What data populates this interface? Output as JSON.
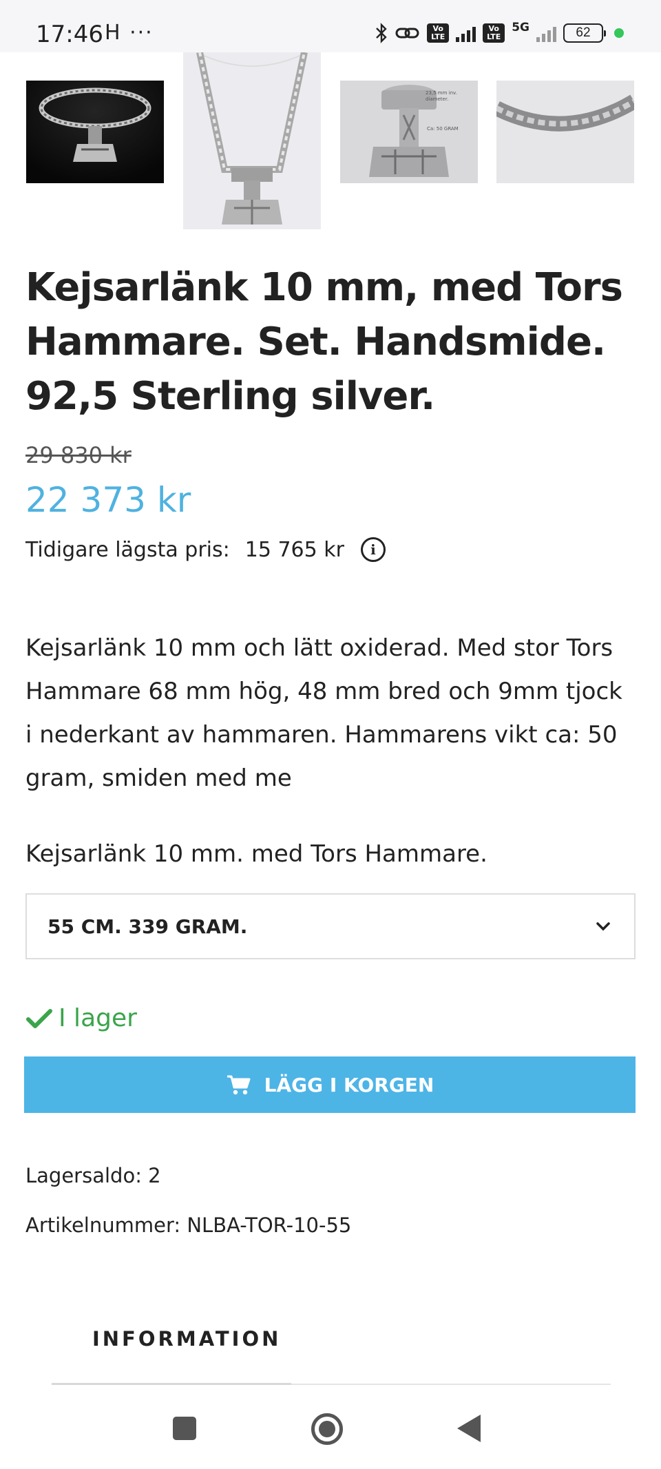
{
  "status_bar": {
    "time": "17:46",
    "left_icons": "H ···",
    "volte_label": "Vo LTE",
    "network": "5G",
    "battery": "62"
  },
  "gallery": {
    "thumb3_label1": "23,5 mm inv. diameter.",
    "thumb3_label2": "Ca: 50 GRAM"
  },
  "product": {
    "title": "Kejsarlänk 10 mm, med Tors Hammare. Set. Handsmide. 92,5 Sterling silver.",
    "old_price": "29 830 kr",
    "price": "22 373 kr",
    "lowest_label": "Tidigare lägsta pris:",
    "lowest_value": "15 765 kr",
    "description": "Kejsarlänk 10 mm och lätt oxiderad. Med stor Tors Hammare 68 mm hög, 48 mm bred och 9mm tjock i nederkant av hammaren. Hammarens vikt ca: 50 gram, smiden med me",
    "subtitle": "Kejsarlänk 10 mm. med Tors Hammare.",
    "variant_selected": "55 CM. 339 GRAM.",
    "stock_status": "I lager",
    "add_to_cart": "LÄGG I KORGEN",
    "stock_count": "Lagersaldo: 2",
    "article_number": "Artikelnummer: NLBA-TOR-10-55"
  },
  "tabs": {
    "information": "INFORMATION"
  },
  "colors": {
    "accent": "#4db4e6",
    "price": "#4fb2e0",
    "in_stock": "#3aa54a"
  },
  "icons": [
    "bluetooth-icon",
    "link-icon",
    "signal-icon",
    "battery-icon",
    "info-icon",
    "chevron-down-icon",
    "check-icon",
    "cart-icon",
    "recents-icon",
    "home-icon",
    "back-icon"
  ]
}
